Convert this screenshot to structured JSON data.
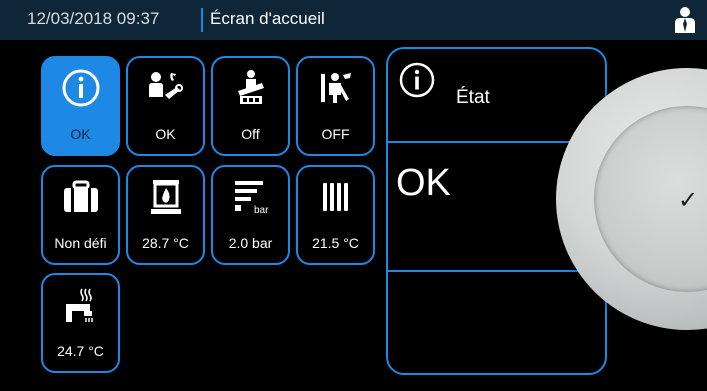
{
  "header": {
    "datetime": "12/03/2018 09:37",
    "screen_title": "Écran d'accueil"
  },
  "tiles": [
    {
      "name": "info",
      "label": "OK",
      "active": true
    },
    {
      "name": "service",
      "label": "OK"
    },
    {
      "name": "chimney",
      "label": "Off"
    },
    {
      "name": "maintenance",
      "label": "OFF"
    },
    {
      "name": "holiday",
      "label": "Non défi"
    },
    {
      "name": "boiler-temp",
      "label": "28.7 °C"
    },
    {
      "name": "pressure",
      "label": "2.0 bar"
    },
    {
      "name": "radiator",
      "label": "21.5 °C"
    },
    {
      "name": "hot-water",
      "label": "24.7 °C"
    }
  ],
  "status_panel": {
    "title": "État",
    "value": "OK"
  },
  "pressure_icon_unit": "bar",
  "colors": {
    "accent": "#1e88e5",
    "header_bg": "#0e2638",
    "panel_bg": "#000000"
  }
}
